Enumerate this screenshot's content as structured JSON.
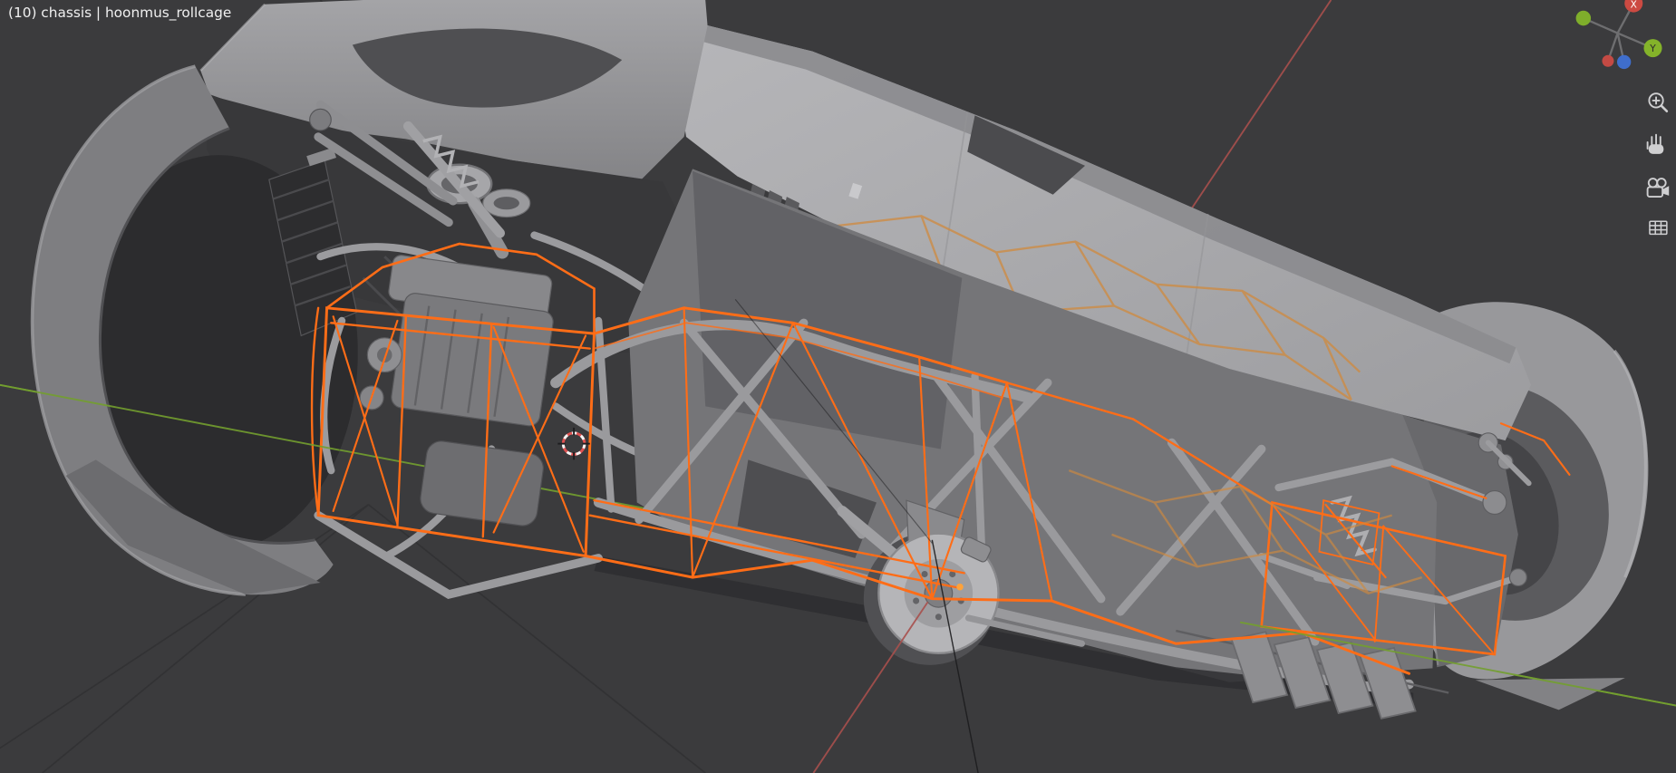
{
  "viewport": {
    "header_text": "(10) chassis | hoonmus_rollcage",
    "background_color": "#3b3b3d"
  },
  "scene": {
    "selected_outline_color": "#ff6d17",
    "xray_outline_color": "#d08a3e",
    "origin_dot_color": "#ffa239",
    "axis_x_color": "#a8504d",
    "axis_y_color": "#739f2f",
    "relationship_line_color": "#1c1c1e"
  },
  "gizmo": {
    "x_label": "X",
    "y_label": "Y",
    "x_color": "#cc4a42",
    "y_color": "#84b32a",
    "z_color": "#3f6ecc",
    "neg_x_color": "#c44a44",
    "neg_y_color": "#7fae2b"
  },
  "nav_controls": [
    {
      "icon": "zoom-plus-icon"
    },
    {
      "icon": "pan-hand-icon"
    },
    {
      "icon": "camera-view-icon"
    },
    {
      "icon": "grid-view-icon"
    }
  ]
}
